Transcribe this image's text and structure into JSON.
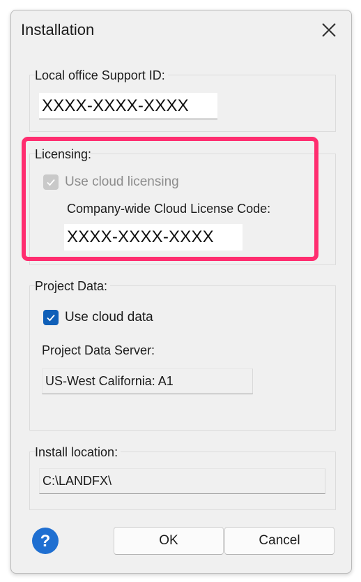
{
  "window": {
    "title": "Installation"
  },
  "support": {
    "label": "Local office Support ID:",
    "value": "XXXX-XXXX-XXXX"
  },
  "licensing": {
    "label": "Licensing:",
    "checkbox_label": "Use cloud licensing",
    "checked": true,
    "disabled": true,
    "code_label": "Company-wide Cloud License Code:",
    "code_value": "XXXX-XXXX-XXXX"
  },
  "project_data": {
    "label": "Project Data:",
    "checkbox_label": "Use cloud data",
    "checked": true,
    "server_label": "Project Data Server:",
    "server_value": "US-West California: A1"
  },
  "install": {
    "label": "Install location:",
    "value": "C:\\LANDFX\\"
  },
  "buttons": {
    "ok": "OK",
    "cancel": "Cancel"
  },
  "colors": {
    "accent": "#0f5fb8",
    "highlight": "#ff2d6f",
    "help": "#1f6fd1"
  },
  "icons": {
    "close": "close-icon",
    "help": "help-icon",
    "check": "check-icon"
  }
}
